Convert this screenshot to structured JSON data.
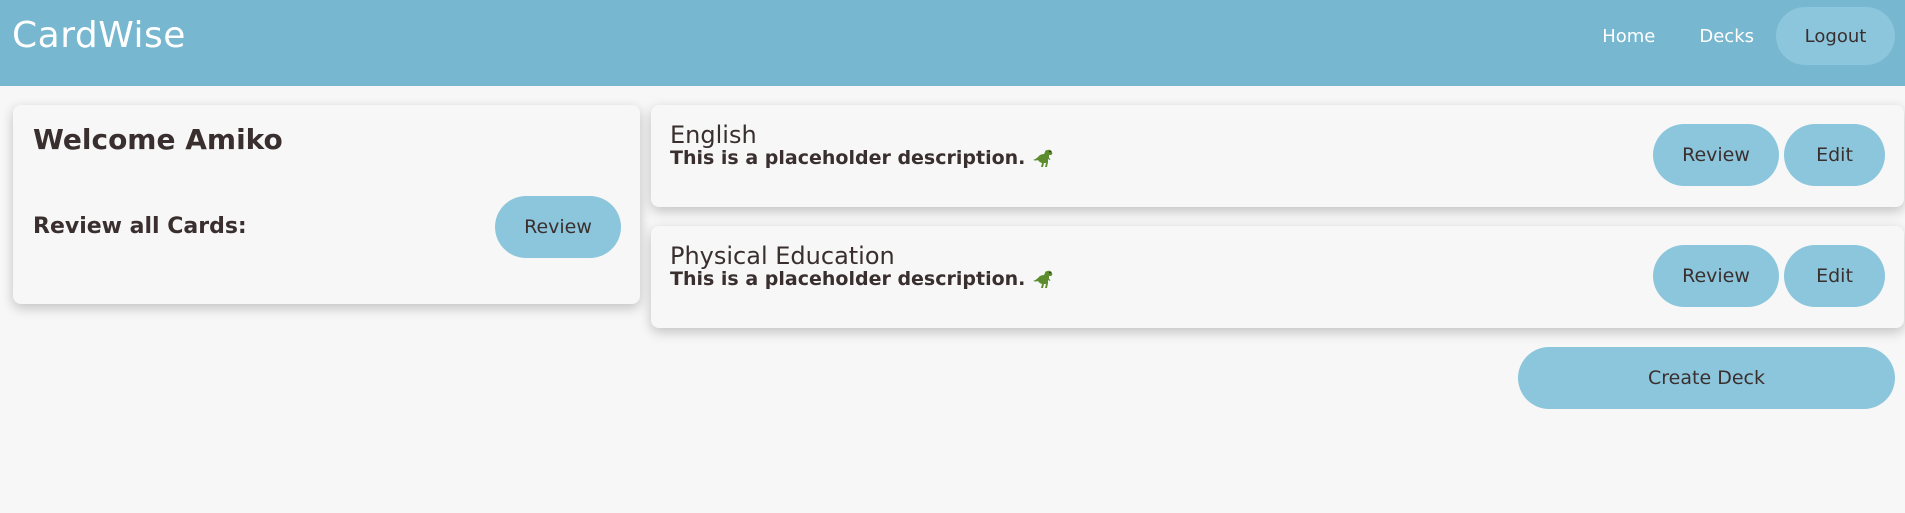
{
  "header": {
    "brand": "CardWise",
    "nav": {
      "home": "Home",
      "decks": "Decks",
      "logout": "Logout"
    },
    "background_color": "#78b7d0"
  },
  "welcome": {
    "title": "Welcome Amiko",
    "review_all_label": "Review all Cards:",
    "review_button": "Review"
  },
  "decks": [
    {
      "name": "English",
      "description": "This is a placeholder description.",
      "icon": "dinosaur-icon",
      "review_button": "Review",
      "edit_button": "Edit"
    },
    {
      "name": "Physical Education",
      "description": "This is a placeholder description.",
      "icon": "dinosaur-icon",
      "review_button": "Review",
      "edit_button": "Edit"
    }
  ],
  "actions": {
    "create_deck": "Create Deck"
  },
  "colors": {
    "button": "#8cc6dc",
    "page_background": "#f7f7f7",
    "text": "#3a2f2f"
  }
}
